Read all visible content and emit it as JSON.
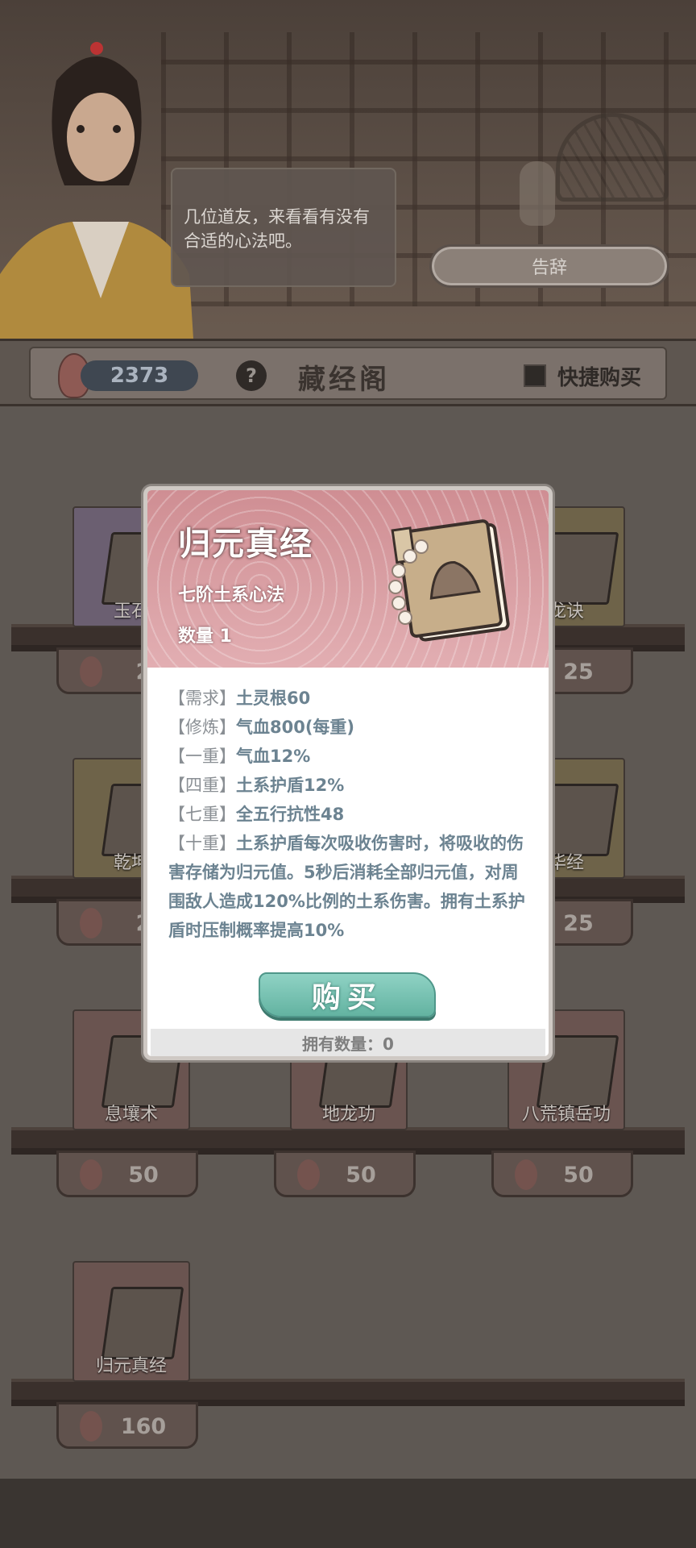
{
  "dialog": {
    "line": "几位道友，来看看有没有合适的心法吧。",
    "leave_button": "告辞"
  },
  "header": {
    "currency": "2373",
    "help_glyph": "?",
    "title": "藏经阁",
    "quick_buy_label": "快捷购买",
    "quick_buy_checked": false
  },
  "shop_items": [
    {
      "name": "玉石",
      "price": "2"
    },
    {
      "name": "龙诀",
      "price": "25"
    },
    {
      "name": "乾坤",
      "price": "2"
    },
    {
      "name": "华经",
      "price": "25"
    },
    {
      "name": "息壤术",
      "price": "50"
    },
    {
      "name": "地龙功",
      "price": "50"
    },
    {
      "name": "八荒镇岳功",
      "price": "50"
    },
    {
      "name": "归元真经",
      "price": "160"
    }
  ],
  "modal": {
    "title": "归元真经",
    "subtitle": "七阶土系心法",
    "quantity": "数量 1",
    "rows": [
      {
        "tag": "【需求】",
        "text": "土灵根60"
      },
      {
        "tag": "【修炼】",
        "text": "气血800(每重)"
      },
      {
        "tag": "【一重】",
        "text": "气血12%"
      },
      {
        "tag": "【四重】",
        "text": "土系护盾12%"
      },
      {
        "tag": "【七重】",
        "text": "全五行抗性48"
      },
      {
        "tag": "【十重】",
        "text": "土系护盾每次吸收伤害时，将吸收的伤害存储为归元值。5秒后消耗全部归元值，对周围敌人造成120%比例的土系伤害。拥有土系护盾时压制概率提高10%"
      }
    ],
    "buy_button": "购买",
    "owned": "拥有数量：0"
  },
  "colors": {
    "modal_header": "#d99ea3",
    "buy_button": "#78c3b2",
    "text_blue": "#6c8391"
  }
}
